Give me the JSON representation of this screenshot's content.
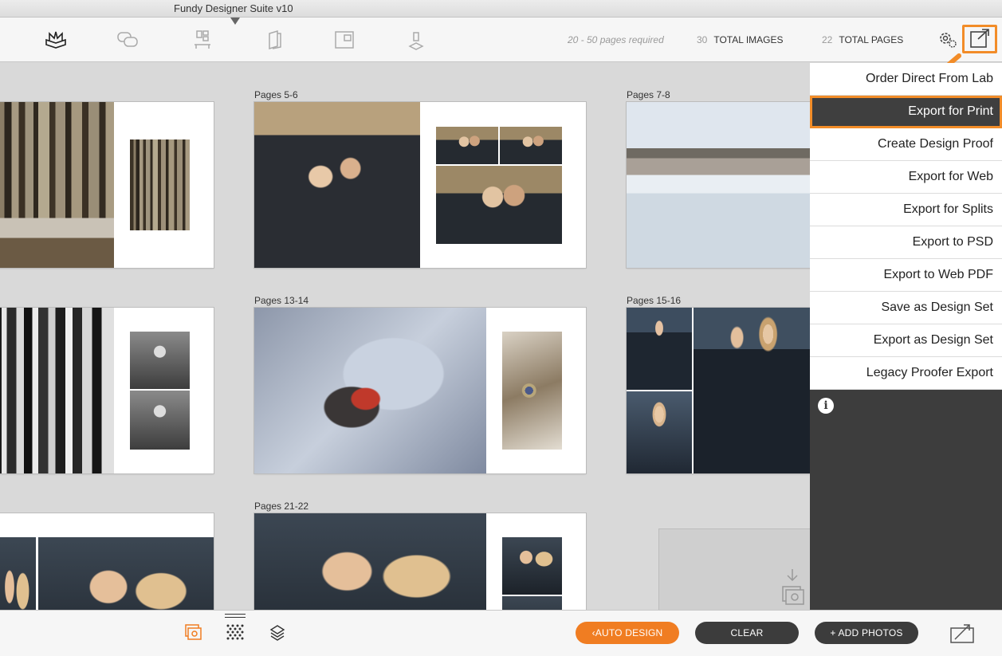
{
  "app": {
    "title": "Fundy Designer Suite v10"
  },
  "toolbar": {
    "pages_required": "20 - 50 pages required",
    "total_images_count": "30",
    "total_images_label": "TOTAL IMAGES",
    "total_pages_count": "22",
    "total_pages_label": "TOTAL PAGES"
  },
  "spreads": [
    {
      "label": ""
    },
    {
      "label": "Pages 5-6"
    },
    {
      "label": "Pages 7-8"
    },
    {
      "label": ""
    },
    {
      "label": "Pages 13-14"
    },
    {
      "label": "Pages 15-16"
    },
    {
      "label": ""
    },
    {
      "label": "Pages 21-22"
    }
  ],
  "export_menu": {
    "items": [
      "Order Direct From Lab",
      "Export for Print",
      "Create Design Proof",
      "Export for Web",
      "Export for Splits",
      "Export to PSD",
      "Export to Web PDF",
      "Save as Design Set",
      "Export as Design Set",
      "Legacy Proofer Export"
    ],
    "active_item": "Export for Print"
  },
  "bottombar": {
    "auto_design": "AUTO DESIGN",
    "clear": "CLEAR",
    "add_photos": "+ ADD PHOTOS"
  },
  "colors": {
    "accent": "#f28c28",
    "dark_button": "#3c3c3c",
    "menu_bg": "#3d3d3d"
  }
}
